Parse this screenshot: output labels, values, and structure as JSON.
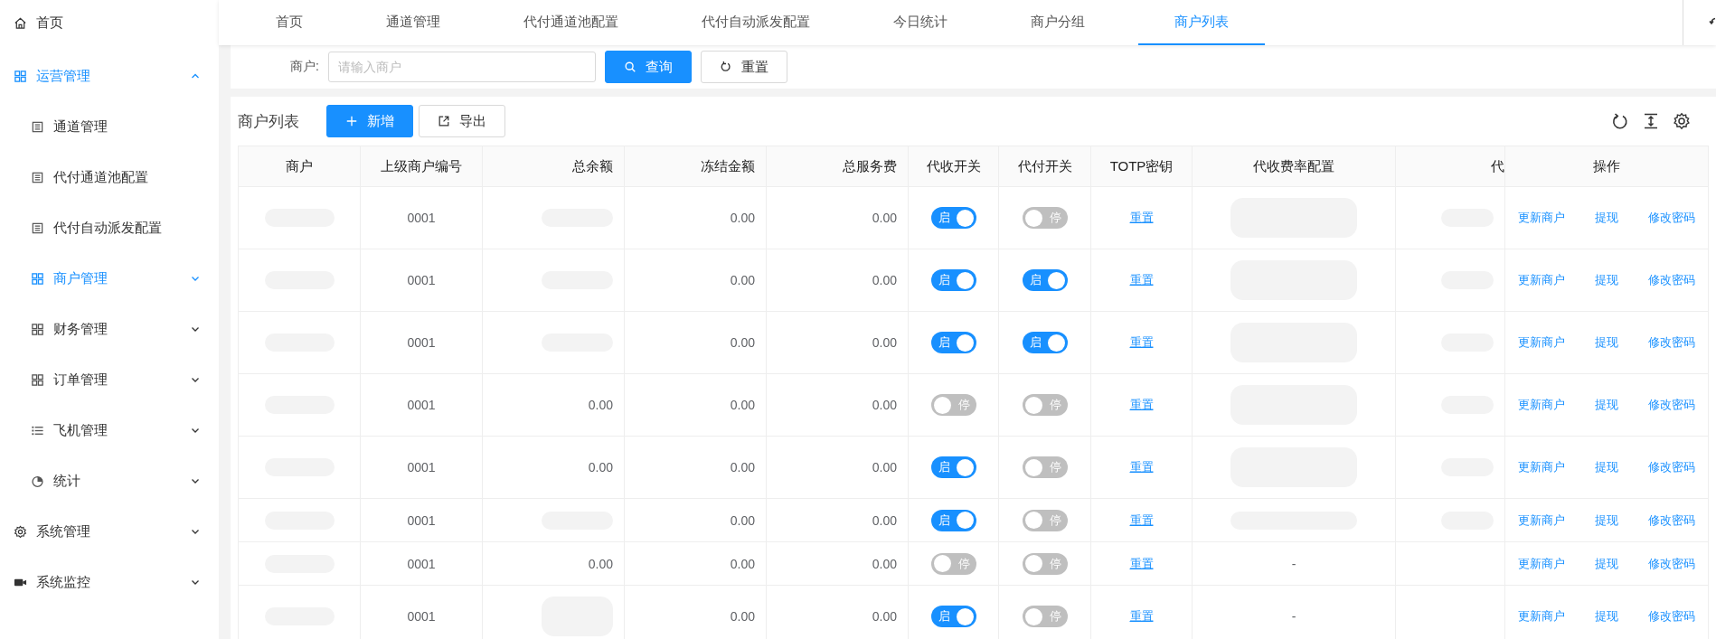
{
  "sidebar": {
    "items": [
      {
        "label": "首页",
        "selected": false
      },
      {
        "label": "运营管理",
        "selected": true,
        "expanded": true,
        "children": [
          {
            "label": "通道管理",
            "selected": false
          },
          {
            "label": "代付通道池配置",
            "selected": false
          },
          {
            "label": "代付自动派发配置",
            "selected": false
          },
          {
            "label": "商户管理",
            "selected": true,
            "expanded": false
          },
          {
            "label": "财务管理",
            "selected": false,
            "expanded": false
          },
          {
            "label": "订单管理",
            "selected": false,
            "expanded": false
          },
          {
            "label": "飞机管理",
            "selected": false,
            "expanded": false
          },
          {
            "label": "统计",
            "selected": false,
            "expanded": false
          }
        ]
      },
      {
        "label": "系统管理",
        "selected": false,
        "expanded": false
      },
      {
        "label": "系统监控",
        "selected": false,
        "expanded": false
      }
    ]
  },
  "tabs": [
    {
      "label": "首页",
      "selected": false
    },
    {
      "label": "通道管理",
      "selected": false
    },
    {
      "label": "代付通道池配置",
      "selected": false
    },
    {
      "label": "代付自动派发配置",
      "selected": false
    },
    {
      "label": "今日统计",
      "selected": false
    },
    {
      "label": "商户分组",
      "selected": false
    },
    {
      "label": "商户列表",
      "selected": true
    }
  ],
  "search": {
    "label": "商户:",
    "placeholder": "请输入商户",
    "query_button": "查询",
    "reset_button": "重置"
  },
  "table_card": {
    "title": "商户列表",
    "add_button": "新增",
    "export_button": "导出"
  },
  "table": {
    "columns": [
      {
        "label": "商户",
        "kind": "text"
      },
      {
        "label": "上级商户编号",
        "kind": "text"
      },
      {
        "label": "总余额",
        "kind": "amount"
      },
      {
        "label": "冻结金额",
        "kind": "amount"
      },
      {
        "label": "总服务费",
        "kind": "amount"
      },
      {
        "label": "代收开关",
        "kind": "switch"
      },
      {
        "label": "代付开关",
        "kind": "switch"
      },
      {
        "label": "TOTP密钥",
        "kind": "link"
      },
      {
        "label": "代收费率配置",
        "kind": "text"
      },
      {
        "label": "代",
        "kind": "amount"
      },
      {
        "label": "操作",
        "kind": "actions"
      }
    ],
    "rows": [
      {
        "cells": [
          {
            "kind": "redaction"
          },
          "0001",
          {
            "kind": "redaction"
          },
          "0.00",
          "0.00",
          {
            "on": true,
            "label": "启"
          },
          {
            "on": false,
            "label": "停"
          },
          "重置",
          {
            "kind": "tall-redaction"
          },
          {
            "kind": "redaction"
          },
          [
            "更新商户",
            "提现",
            "修改密码"
          ]
        ]
      },
      {
        "cells": [
          {
            "kind": "redaction"
          },
          "0001",
          {
            "kind": "redaction"
          },
          "0.00",
          "0.00",
          {
            "on": true,
            "label": "启"
          },
          {
            "on": true,
            "label": "启"
          },
          "重置",
          {
            "kind": "tall-redaction"
          },
          {
            "kind": "redaction"
          },
          [
            "更新商户",
            "提现",
            "修改密码"
          ]
        ]
      },
      {
        "cells": [
          {
            "kind": "redaction"
          },
          "0001",
          {
            "kind": "redaction"
          },
          "0.00",
          "0.00",
          {
            "on": true,
            "label": "启"
          },
          {
            "on": true,
            "label": "启"
          },
          "重置",
          {
            "kind": "tall-redaction"
          },
          {
            "kind": "redaction"
          },
          [
            "更新商户",
            "提现",
            "修改密码"
          ]
        ]
      },
      {
        "cells": [
          {
            "kind": "redaction"
          },
          "0001",
          "0.00",
          "0.00",
          "0.00",
          {
            "on": false,
            "label": "停"
          },
          {
            "on": false,
            "label": "停"
          },
          "重置",
          {
            "kind": "tall-redaction"
          },
          {
            "kind": "redaction"
          },
          [
            "更新商户",
            "提现",
            "修改密码"
          ]
        ]
      },
      {
        "cells": [
          {
            "kind": "redaction"
          },
          "0001",
          "0.00",
          "0.00",
          "0.00",
          {
            "on": true,
            "label": "启"
          },
          {
            "on": false,
            "label": "停"
          },
          "重置",
          {
            "kind": "tall-redaction"
          },
          {
            "kind": "redaction"
          },
          [
            "更新商户",
            "提现",
            "修改密码"
          ]
        ]
      },
      {
        "cells": [
          {
            "kind": "redaction"
          },
          "0001",
          {
            "kind": "redaction"
          },
          "0.00",
          "0.00",
          {
            "on": true,
            "label": "启"
          },
          {
            "on": false,
            "label": "停"
          },
          "重置",
          {
            "kind": "redaction"
          },
          {
            "kind": "redaction"
          },
          [
            "更新商户",
            "提现",
            "修改密码"
          ]
        ]
      },
      {
        "cells": [
          {
            "kind": "redaction"
          },
          "0001",
          "0.00",
          "0.00",
          "0.00",
          {
            "on": false,
            "label": "停"
          },
          {
            "on": false,
            "label": "停"
          },
          "重置",
          "-",
          null,
          [
            "更新商户",
            "提现",
            "修改密码"
          ]
        ]
      },
      {
        "cells": [
          {
            "kind": "redaction"
          },
          "0001",
          {
            "kind": "tall-redaction"
          },
          "0.00",
          "0.00",
          {
            "on": true,
            "label": "启"
          },
          {
            "on": false,
            "label": "停"
          },
          "重置",
          "-",
          null,
          [
            "更新商户",
            "提现",
            "修改密码"
          ]
        ]
      }
    ]
  }
}
